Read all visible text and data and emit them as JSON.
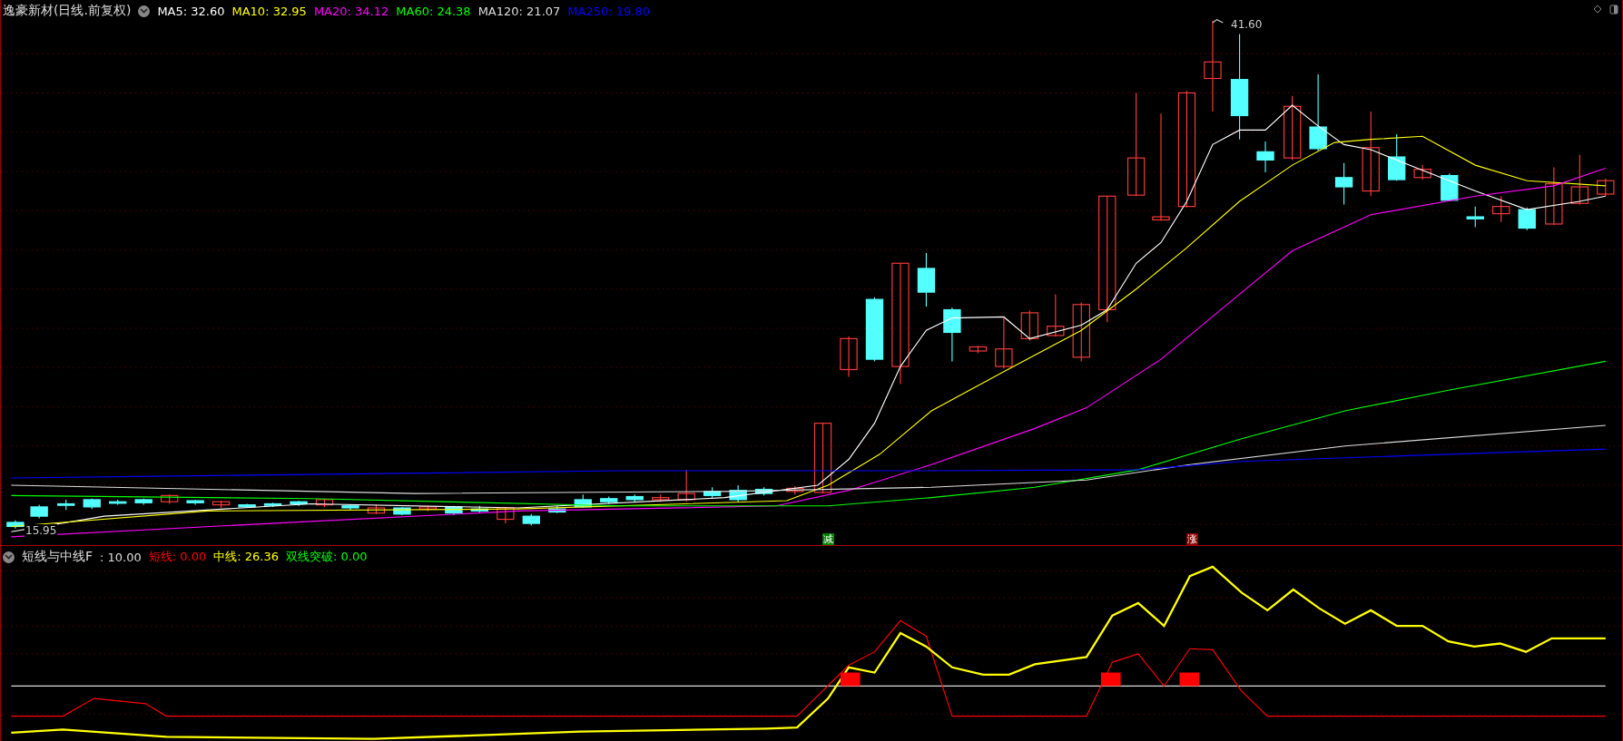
{
  "title": "逸豪新材(日线.前复权)",
  "ma_legend": [
    {
      "label": "MA5: 32.60",
      "color": "#ffffff"
    },
    {
      "label": "MA10: 32.95",
      "color": "#ffff00"
    },
    {
      "label": "MA20: 34.12",
      "color": "#ff00ff"
    },
    {
      "label": "MA60: 24.38",
      "color": "#00ff00"
    },
    {
      "label": "MA120: 21.07",
      "color": "#dddddd"
    },
    {
      "label": "MA250: 19.80",
      "color": "#0000ff"
    }
  ],
  "price_chart": {
    "high_label": "41.60",
    "low_label": "15.95",
    "signals": [
      {
        "text": "减",
        "kind": "reduce"
      },
      {
        "text": "涨",
        "kind": "rise"
      }
    ]
  },
  "indicator": {
    "title": "短线与中线F",
    "param": ": 10.00",
    "legend": [
      {
        "label": "短线: 0.00",
        "color": "#ff0000"
      },
      {
        "label": "中线: 26.36",
        "color": "#ffff00"
      },
      {
        "label": "双线突破: 0.00",
        "color": "#00ff00"
      }
    ]
  }
}
